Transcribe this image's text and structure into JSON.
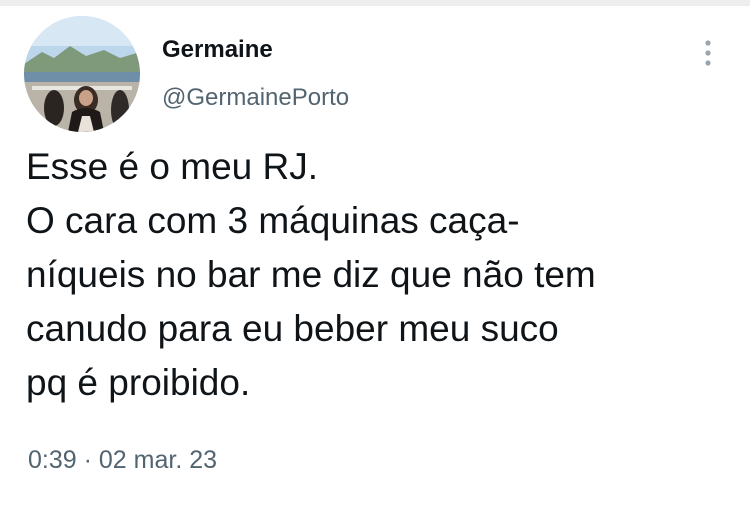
{
  "tweet": {
    "author": {
      "display_name": "Germaine",
      "handle": "@GermainePorto"
    },
    "text_lines": [
      "Esse é o meu RJ.",
      "O cara com 3 máquinas caça-",
      "níqueis no bar me diz que não tem",
      "canudo para eu beber meu suco",
      "pq é proibido."
    ],
    "time": "0:39",
    "separator": "·",
    "date": "02 mar. 23"
  },
  "icons": {
    "more": "more-options-icon",
    "avatar": "profile-photo"
  },
  "colors": {
    "text_primary": "#0f1419",
    "text_secondary": "#536471",
    "background": "#ffffff"
  }
}
